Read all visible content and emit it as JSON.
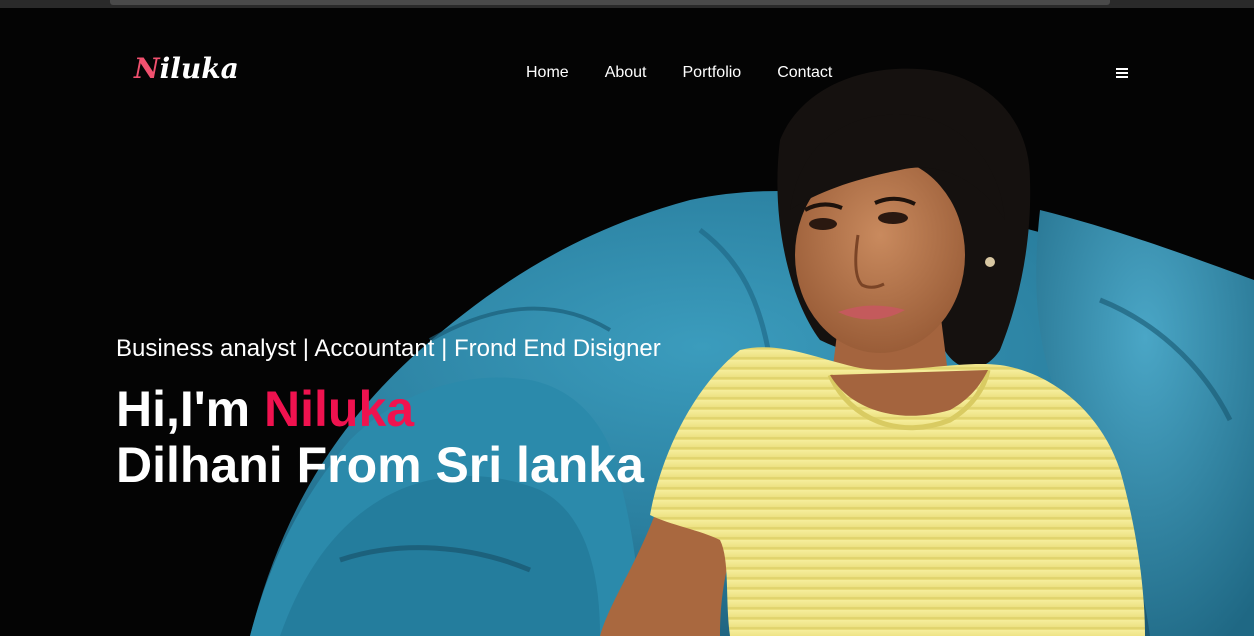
{
  "brand": {
    "logo_first": "N",
    "logo_rest": "iluka"
  },
  "nav": {
    "items": [
      "Home",
      "About",
      "Portfolio",
      "Contact"
    ]
  },
  "menu": {
    "icon": "hamburger-menu-icon"
  },
  "hero": {
    "subtitle": "Business analyst | Accountant | Frond End Disigner",
    "greeting": "Hi,I'm ",
    "name": "Niluka",
    "line2": "Dilhani From Sri lanka"
  },
  "colors": {
    "background": "#040404",
    "accent": "#f0124f",
    "logo_accent": "#f0506e",
    "beanbag": "#2f86a6",
    "shirt": "#f2e78a"
  }
}
